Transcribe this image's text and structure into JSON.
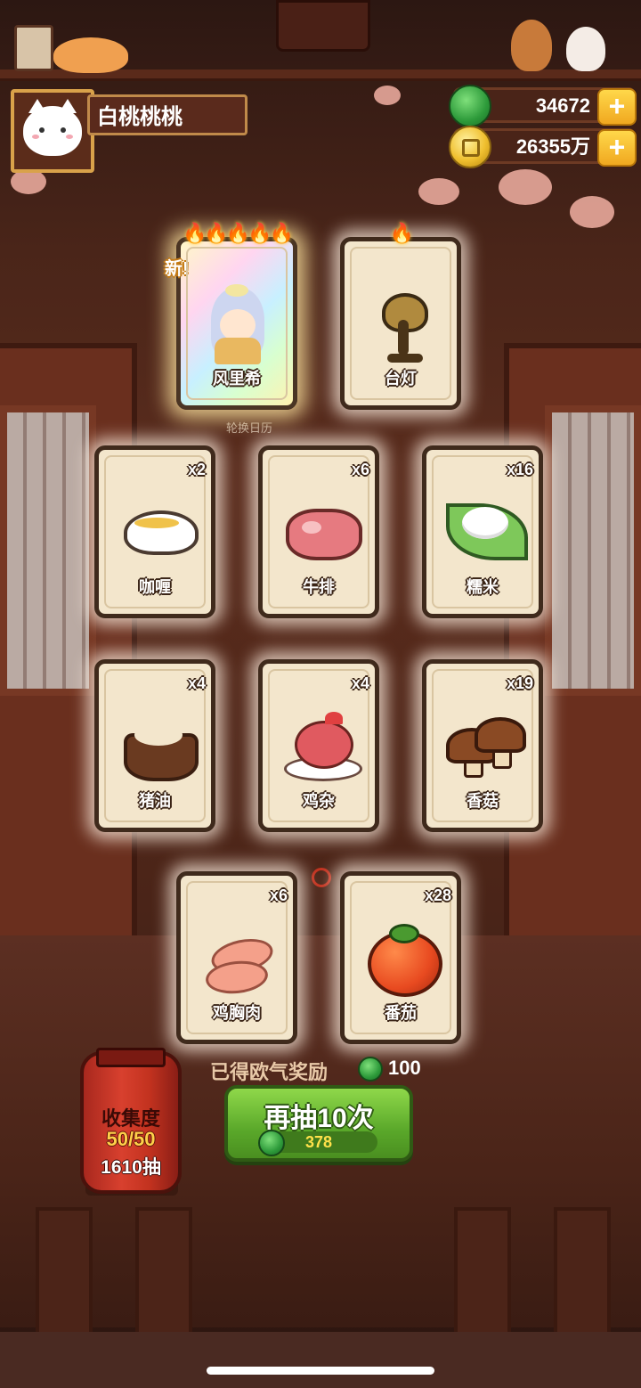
{
  "player": {
    "name": "白桃桃桃"
  },
  "currencies": [
    {
      "kind": "jade",
      "icon": "jade-coin-icon",
      "value": "34672"
    },
    {
      "kind": "gold",
      "icon": "copper-coin-icon",
      "value": "26355万"
    }
  ],
  "background_label": "轮换日历",
  "top_cards": [
    {
      "name": "风里希",
      "flames": "🔥🔥🔥🔥🔥",
      "new_tag": "新!",
      "icon": "character-fenglixi"
    },
    {
      "name": "台灯",
      "flames": "🔥",
      "icon": "desk-lamp-icon"
    }
  ],
  "item_cards": [
    {
      "name": "咖喱",
      "qty": "x2",
      "icon": "curry-icon"
    },
    {
      "name": "牛排",
      "qty": "x6",
      "icon": "steak-icon"
    },
    {
      "name": "糯米",
      "qty": "x16",
      "icon": "glutinous-rice-icon"
    },
    {
      "name": "猪油",
      "qty": "x4",
      "icon": "lard-icon"
    },
    {
      "name": "鸡杂",
      "qty": "x4",
      "icon": "chicken-giblets-icon"
    },
    {
      "name": "香菇",
      "qty": "x19",
      "icon": "shiitake-icon"
    },
    {
      "name": "鸡胸肉",
      "qty": "x6",
      "icon": "chicken-breast-icon"
    },
    {
      "name": "番茄",
      "qty": "x28",
      "icon": "tomato-icon"
    }
  ],
  "reward": {
    "label": "已得欧气奖励",
    "value": "100"
  },
  "draw_button": {
    "label": "再抽10次",
    "cost": "378"
  },
  "collection": {
    "title": "收集度",
    "progress": "50/50",
    "draws": "1610抽"
  },
  "colors": {
    "accent_green": "#5aa82a",
    "card_bg": "#f3e6cc",
    "lantern_red": "#c2321f",
    "gold": "#f0c030"
  }
}
